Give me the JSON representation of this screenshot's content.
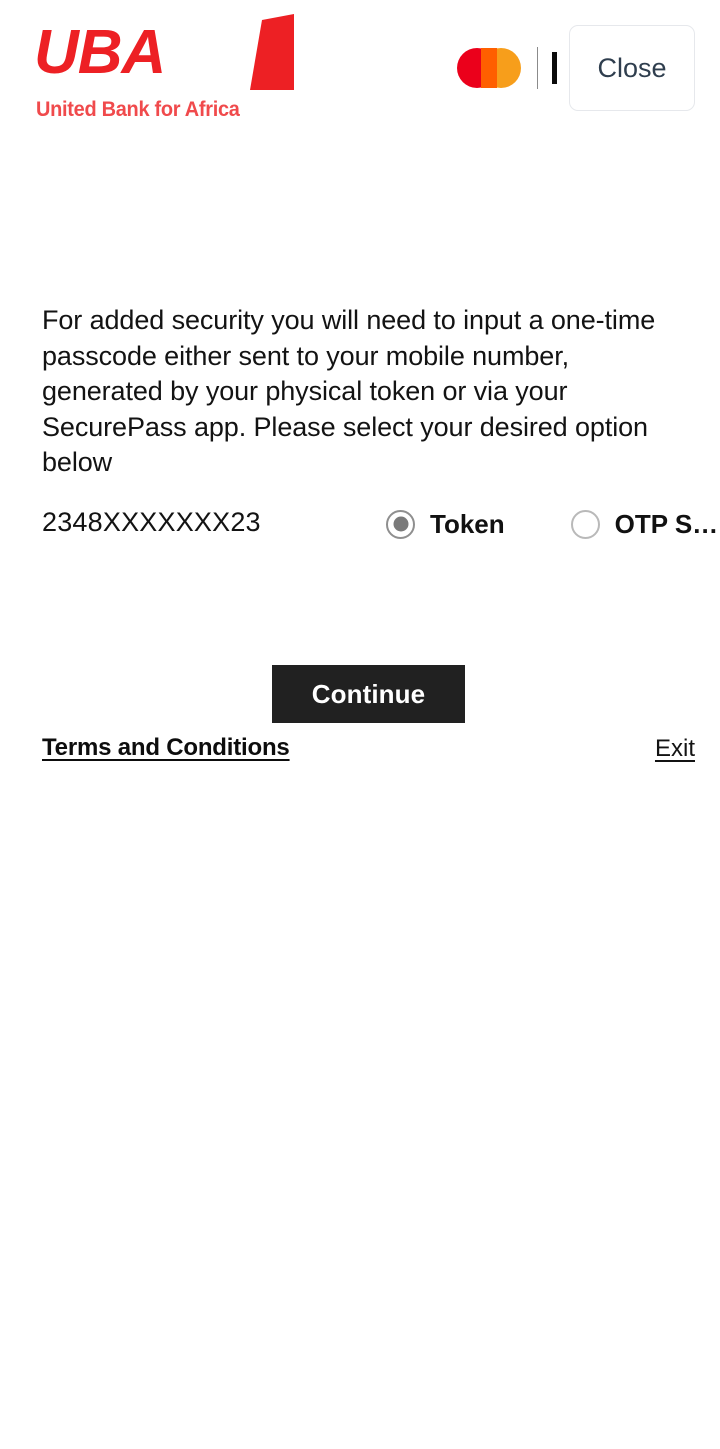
{
  "header": {
    "brand": {
      "wordmark": "UBA",
      "tagline": "United Bank for Africa",
      "logo_color": "#ED2024",
      "flag_icon": "uba-flag-icon"
    },
    "card_scheme": {
      "name": "mastercard-logo",
      "left_circle_color": "#EB001B",
      "right_circle_color": "#F79E1B",
      "overlap_color": "#FF5F00"
    },
    "close_label": "Close"
  },
  "main": {
    "intro_text": "For added security you will need to input a one-time passcode either sent to your mobile number, generated by your physical token or via your SecurePass app. Please select your desired option below",
    "msisdn": "2348XXXXXXX23",
    "options": [
      {
        "label": "Token",
        "value": "token",
        "checked": true
      },
      {
        "label": "OTP S…",
        "value": "otp_sms",
        "checked": false
      }
    ],
    "continue_label": "Continue"
  },
  "footer": {
    "terms_label": "Terms and Conditions",
    "exit_label": "Exit"
  }
}
